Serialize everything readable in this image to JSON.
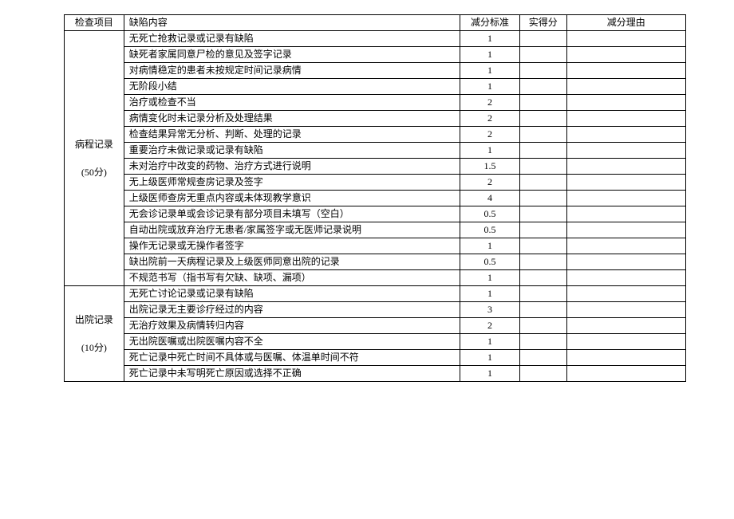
{
  "headers": {
    "check_item": "检查项目",
    "defect_content": "缺陷内容",
    "deduct_std": "减分标准",
    "actual_score": "实得分",
    "deduct_reason": "减分理由"
  },
  "sections": [
    {
      "name": "病程记录",
      "points": "(50分)",
      "rows": [
        {
          "defect": "无死亡抢救记录或记录有缺陷",
          "std": "1"
        },
        {
          "defect": "缺死者家属同意尸检的意见及签字记录",
          "std": "1"
        },
        {
          "defect": "对病情稳定的患者未按规定时间记录病情",
          "std": "1"
        },
        {
          "defect": "无阶段小结",
          "std": "1"
        },
        {
          "defect": "治疗或检查不当",
          "std": "2"
        },
        {
          "defect": "病情变化时未记录分析及处理结果",
          "std": "2"
        },
        {
          "defect": "检查结果异常无分析、判断、处理的记录",
          "std": "2"
        },
        {
          "defect": "重要治疗未做记录或记录有缺陷",
          "std": "1"
        },
        {
          "defect": "未对治疗中改变的药物、治疗方式进行说明",
          "std": "1.5"
        },
        {
          "defect": "无上级医师常规查房记录及签字",
          "std": "2"
        },
        {
          "defect": "上级医师查房无重点内容或未体现教学意识",
          "std": "4"
        },
        {
          "defect": "无会诊记录单或会诊记录有部分项目未填写（空白）",
          "std": "0.5"
        },
        {
          "defect": "自动出院或放弃治疗无患者/家属签字或无医师记录说明",
          "std": "0.5"
        },
        {
          "defect": "操作无记录或无操作者签字",
          "std": "1"
        },
        {
          "defect": "缺出院前一天病程记录及上级医师同意出院的记录",
          "std": "0.5"
        },
        {
          "defect": "不规范书写（指书写有欠缺、缺项、漏项）",
          "std": "1"
        }
      ]
    },
    {
      "name": "出院记录",
      "points": "(10分)",
      "rows": [
        {
          "defect": "无死亡讨论记录或记录有缺陷",
          "std": "1"
        },
        {
          "defect": "出院记录无主要诊疗经过的内容",
          "std": "3"
        },
        {
          "defect": "无治疗效果及病情转归内容",
          "std": "2"
        },
        {
          "defect": "无出院医嘱或出院医嘱内容不全",
          "std": "1"
        },
        {
          "defect": "死亡记录中死亡时间不具体或与医嘱、体温单时间不符",
          "std": "1"
        },
        {
          "defect": "死亡记录中未写明死亡原因或选择不正确",
          "std": "1"
        }
      ]
    }
  ]
}
